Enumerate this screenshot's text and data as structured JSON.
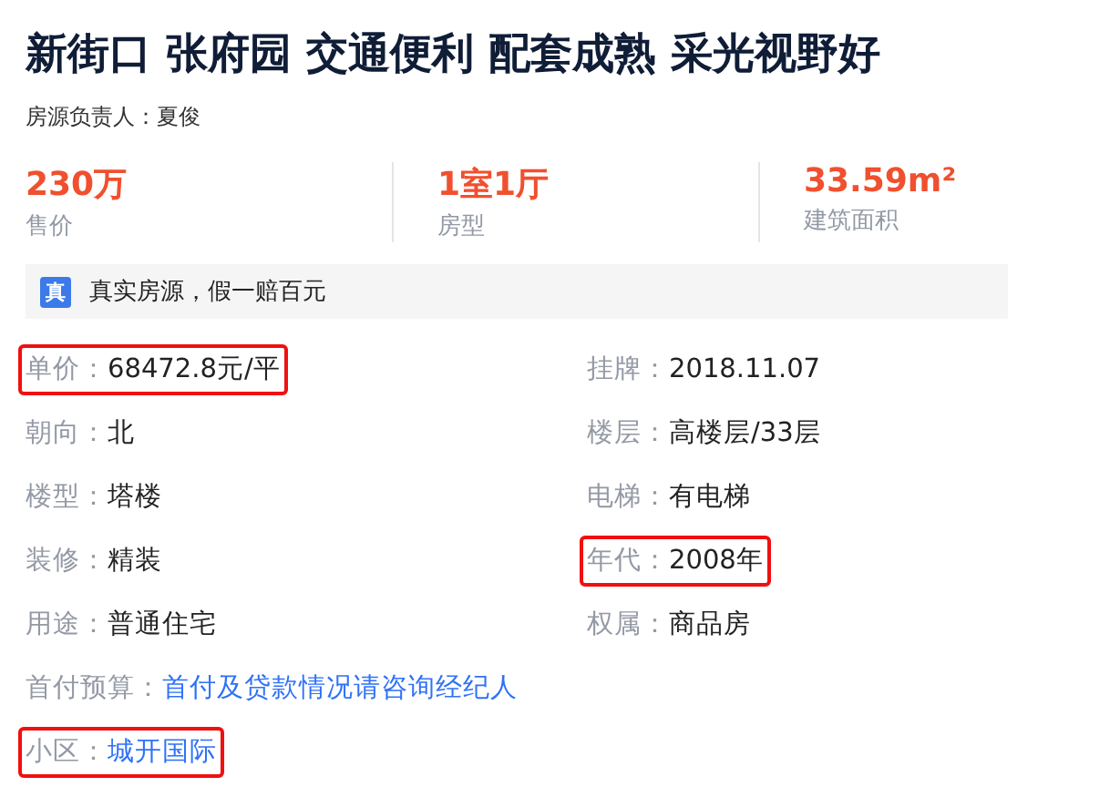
{
  "title": "新街口 张府园 交通便利 配套成熟 采光视野好",
  "agent": "房源负责人：夏俊",
  "stats": [
    {
      "value": "230万",
      "label": "售价"
    },
    {
      "value": "1室1厅",
      "label": "房型"
    },
    {
      "value": "33.59m²",
      "label": "建筑面积"
    }
  ],
  "banner": {
    "badge": "真",
    "text": "真实房源，假一赔百元"
  },
  "details": [
    {
      "label": "单价：",
      "value": "68472.8元/平",
      "kind": "text",
      "highlighted": true
    },
    {
      "label": "挂牌：",
      "value": "2018.11.07",
      "kind": "text",
      "highlighted": false
    },
    {
      "label": "朝向：",
      "value": "北",
      "kind": "text",
      "highlighted": false
    },
    {
      "label": "楼层：",
      "value": "高楼层/33层",
      "kind": "text",
      "highlighted": false
    },
    {
      "label": "楼型：",
      "value": "塔楼",
      "kind": "text",
      "highlighted": false
    },
    {
      "label": "电梯：",
      "value": "有电梯",
      "kind": "text",
      "highlighted": false
    },
    {
      "label": "装修：",
      "value": "精装",
      "kind": "text",
      "highlighted": false
    },
    {
      "label": "年代：",
      "value": "2008年",
      "kind": "text",
      "highlighted": true
    },
    {
      "label": "用途：",
      "value": "普通住宅",
      "kind": "text",
      "highlighted": false
    },
    {
      "label": "权属：",
      "value": "商品房",
      "kind": "text",
      "highlighted": false
    },
    {
      "label": "首付预算：",
      "value": "首付及贷款情况请咨询经纪人",
      "kind": "link",
      "highlighted": false,
      "wide": true
    },
    {
      "label": "小区：",
      "value": "城开国际",
      "kind": "link",
      "highlighted": true,
      "wide": true
    }
  ]
}
